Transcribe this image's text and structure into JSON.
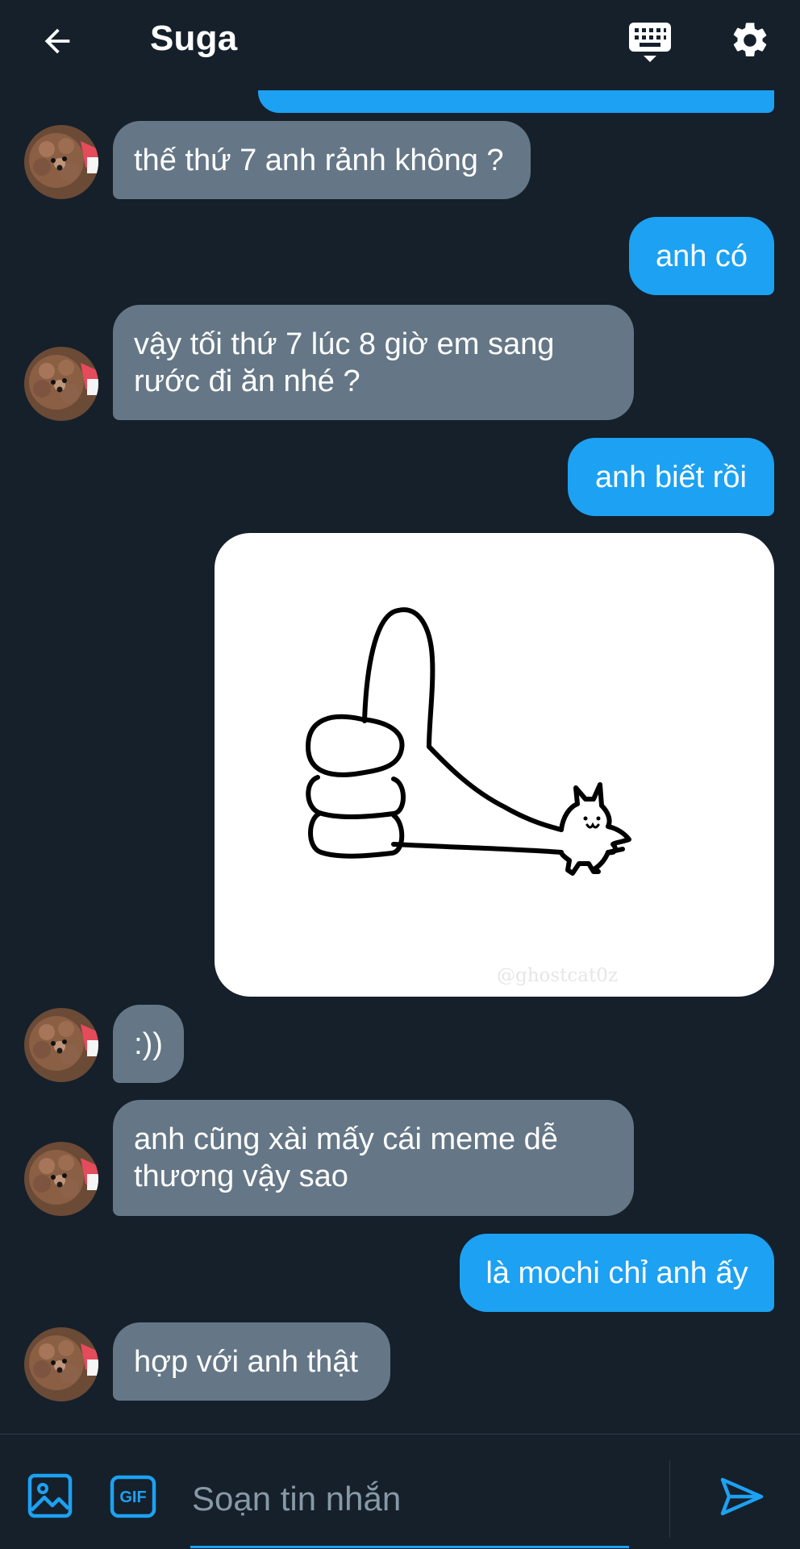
{
  "header": {
    "title": "Suga",
    "back_icon": "arrow-left-icon",
    "keyboard_icon": "keyboard-icon",
    "settings_icon": "gear-icon"
  },
  "messages": [
    {
      "direction": "in",
      "text": "thế thứ 7 anh rảnh không ?"
    },
    {
      "direction": "out",
      "text": "anh có"
    },
    {
      "direction": "in",
      "text": "vậy tối thứ 7 lúc 8 giờ em sang\nrước đi ăn nhé ?"
    },
    {
      "direction": "out",
      "text": "anh biết rồi"
    },
    {
      "direction": "out",
      "type": "image",
      "watermark": "@ghostcat0z",
      "image_subject": "thumbs-up-cat"
    },
    {
      "direction": "in",
      "text": ":))"
    },
    {
      "direction": "in",
      "text": "anh cũng xài mấy cái meme dễ\nthương vậy sao"
    },
    {
      "direction": "out",
      "text": "là mochi chỉ anh ấy"
    },
    {
      "direction": "in",
      "text": "hợp với anh thật"
    }
  ],
  "composer": {
    "placeholder": "Soạn tin nhắn",
    "gif_label": "GIF",
    "image_icon": "image-icon",
    "send_icon": "send-icon"
  },
  "colors": {
    "background": "#15202b",
    "incoming_bubble": "#657786",
    "outgoing_bubble": "#1da1f2",
    "accent": "#1da1f2"
  }
}
